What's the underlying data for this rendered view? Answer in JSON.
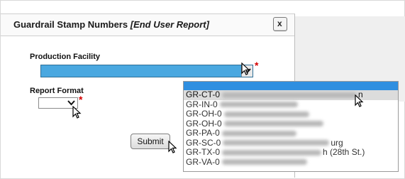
{
  "dialog": {
    "title": "Guardrail Stamp Numbers",
    "title_suffix": "[End User Report]",
    "close_label": "x"
  },
  "form": {
    "facility_label": "Production Facility",
    "facility_value": "",
    "format_label": "Report Format",
    "format_value": "",
    "required_mark": "*",
    "submit_label": "Submit"
  },
  "dropdown": {
    "items": [
      {
        "prefix": "GR-CT-0",
        "tail": "n"
      },
      {
        "prefix": "GR-IN-0",
        "tail": ""
      },
      {
        "prefix": "GR-OH-0",
        "tail": ""
      },
      {
        "prefix": "GR-OH-0",
        "tail": ""
      },
      {
        "prefix": "GR-PA-0",
        "tail": ""
      },
      {
        "prefix": "GR-SC-0",
        "tail": "urg"
      },
      {
        "prefix": "GR-TX-0",
        "tail": "h (28th St.)"
      },
      {
        "prefix": "GR-VA-0",
        "tail": ""
      }
    ]
  },
  "colors": {
    "select_highlight": "#4aa8e0",
    "list_header": "#2f8fe0",
    "required": "#d40000"
  }
}
